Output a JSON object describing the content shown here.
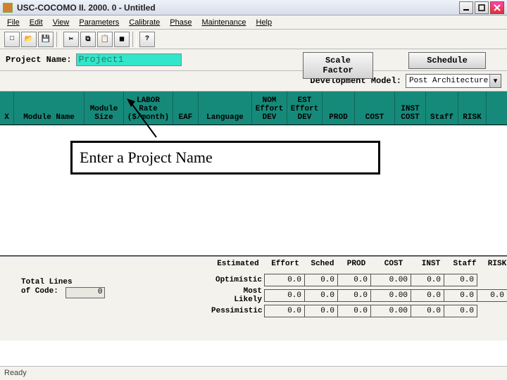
{
  "window": {
    "title": "USC-COCOMO II. 2000. 0 - Untitled"
  },
  "menus": [
    "File",
    "Edit",
    "View",
    "Parameters",
    "Calibrate",
    "Phase",
    "Maintenance",
    "Help"
  ],
  "toolbar_icons": [
    "new",
    "open",
    "save",
    "cut",
    "copy",
    "paste",
    "calc",
    "help"
  ],
  "project": {
    "label": "Project Name:",
    "name": "Project1",
    "scale_btn": "Scale Factor",
    "schedule_btn": "Schedule",
    "devmodel_label": "Development Model:",
    "devmodel_value": "Post Architecture"
  },
  "columns": {
    "x": "X",
    "mname": "Module Name",
    "msize": "Module Size",
    "labor": "LABOR Rate ($/month)",
    "eaf": "EAF",
    "lang": "Language",
    "nom": "NOM Effort DEV",
    "est": "EST Effort DEV",
    "prod": "PROD",
    "cost": "COST",
    "inst": "INST COST",
    "staff": "Staff",
    "risk": "RISK"
  },
  "callout": "Enter a Project Name",
  "totals": {
    "label1": "Total Lines",
    "label2": "of Code:",
    "value": "0"
  },
  "sum_headers": [
    "Estimated",
    "Effort",
    "Sched",
    "PROD",
    "COST",
    "INST",
    "Staff",
    "RISK"
  ],
  "sum_rows": [
    {
      "label": "Optimistic",
      "vals": [
        "0.0",
        "0.0",
        "0.0",
        "0.00",
        "0.0",
        "0.0",
        ""
      ]
    },
    {
      "label": "Most Likely",
      "vals": [
        "0.0",
        "0.0",
        "0.0",
        "0.00",
        "0.0",
        "0.0",
        "0.0"
      ]
    },
    {
      "label": "Pessimistic",
      "vals": [
        "0.0",
        "0.0",
        "0.0",
        "0.00",
        "0.0",
        "0.0",
        ""
      ]
    }
  ],
  "status": "Ready"
}
